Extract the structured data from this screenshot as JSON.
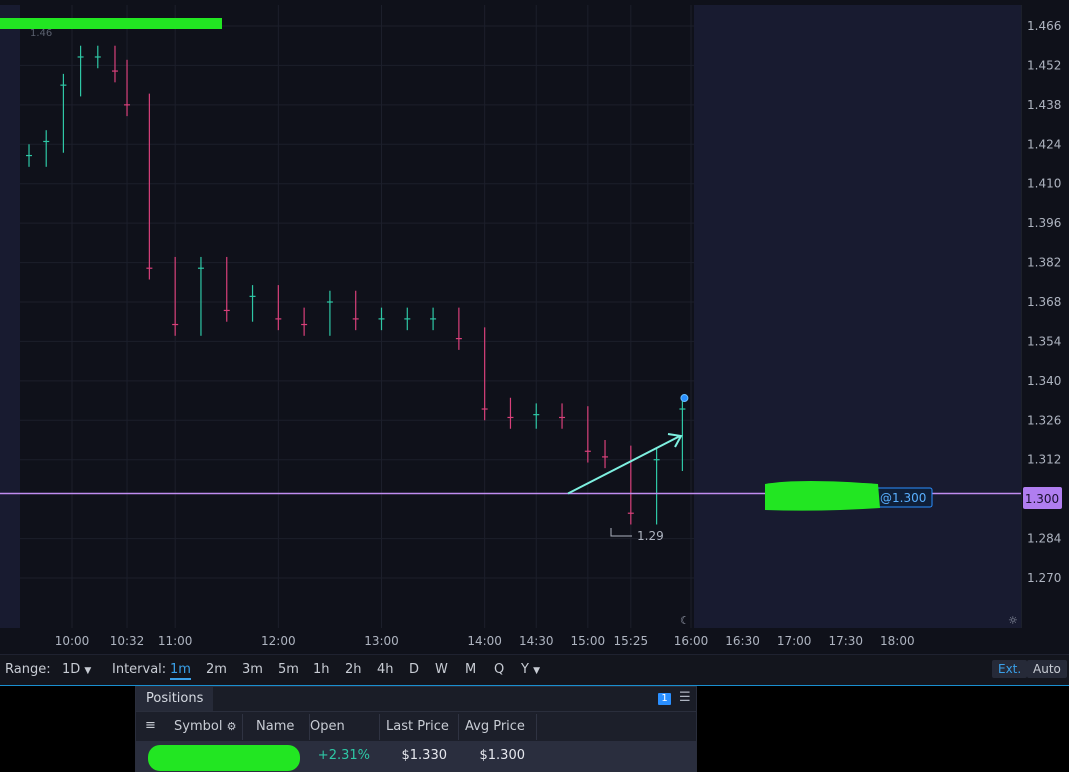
{
  "chart": {
    "legend_first_price": "1.46",
    "price_ticks": [
      "1.466",
      "1.452",
      "1.438",
      "1.424",
      "1.410",
      "1.396",
      "1.382",
      "1.368",
      "1.354",
      "1.340",
      "1.326",
      "1.312",
      "1.300",
      "1.284",
      "1.270"
    ],
    "current_price": "1.300",
    "order_label": "@1.300",
    "low_marker": "1.29",
    "time_ticks": [
      "10:00",
      "10:32",
      "11:00",
      "12:00",
      "13:00",
      "14:00",
      "14:30",
      "15:00",
      "15:25",
      "16:00",
      "16:30",
      "17:00",
      "17:30",
      "18:00"
    ],
    "colors": {
      "background": "#0f111a",
      "after_hours": "#181b30",
      "up_candle": "#2ec7a5",
      "down_candle": "#d8407a",
      "price_line": "#c08cf0",
      "arrow": "#7ef0e0",
      "redaction": "#22e622"
    }
  },
  "chart_data": {
    "type": "candlestick",
    "x": [
      "9:35",
      "9:45",
      "9:55",
      "10:05",
      "10:15",
      "10:25",
      "10:32",
      "10:45",
      "11:00",
      "11:15",
      "11:30",
      "11:45",
      "12:00",
      "12:15",
      "12:30",
      "12:45",
      "13:00",
      "13:15",
      "13:30",
      "13:45",
      "14:00",
      "14:15",
      "14:30",
      "14:45",
      "15:00",
      "15:10",
      "15:25",
      "15:40",
      "15:55"
    ],
    "close": [
      1.42,
      1.425,
      1.445,
      1.455,
      1.455,
      1.45,
      1.438,
      1.38,
      1.36,
      1.38,
      1.365,
      1.37,
      1.362,
      1.36,
      1.368,
      1.362,
      1.362,
      1.362,
      1.362,
      1.355,
      1.33,
      1.327,
      1.328,
      1.327,
      1.315,
      1.313,
      1.293,
      1.312,
      1.33
    ],
    "xlim": [
      "9:30",
      "18:30"
    ],
    "ylim": [
      1.262,
      1.47
    ]
  },
  "toolbar": {
    "range_label": "Range:",
    "range_value": "1D",
    "interval_label": "Interval:",
    "intervals": [
      "1m",
      "2m",
      "3m",
      "5m",
      "1h",
      "2h",
      "4h",
      "D",
      "W",
      "M",
      "Q",
      "Y"
    ],
    "active_interval": "1m",
    "ext": "Ext.",
    "auto": "Auto"
  },
  "positions": {
    "tab": "Positions",
    "badge": "1",
    "columns": [
      "Symbol",
      "Name",
      "Open P&...",
      "Last Price",
      "Avg Price"
    ],
    "row": {
      "open_pnl": "+2.31%",
      "last_price": "$1.330",
      "avg_price": "$1.300"
    }
  }
}
